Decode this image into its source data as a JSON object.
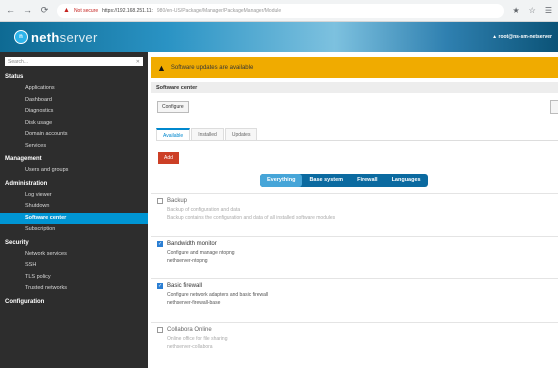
{
  "browser": {
    "nav_back": "←",
    "nav_forward": "→",
    "nav_reload": "⟳",
    "nav_home": "⌂",
    "insecure_label": "Not secure",
    "url_host": "https://192.168.251.11:",
    "url_path": "980/en-US/Package/Manager/PackageManager/Module",
    "bar_icons": [
      "★",
      "☆",
      "☰"
    ]
  },
  "app": {
    "logo_mark": "n",
    "logo_word": "neth",
    "logo_word_light": "server",
    "user_label": "▲ root@ns-sm-netserver"
  },
  "sidebar": {
    "search_placeholder": "Search...",
    "search_clear": "✕",
    "sections": [
      {
        "title": "Status",
        "items": [
          "Applications",
          "Dashboard",
          "Diagnostics",
          "Disk usage",
          "Domain accounts",
          "Services"
        ]
      },
      {
        "title": "Management",
        "items": [
          "Users and groups"
        ]
      },
      {
        "title": "Administration",
        "items": [
          "Log viewer",
          "Shutdown",
          "Software center",
          "Subscription"
        ]
      },
      {
        "title": "Security",
        "items": [
          "Network services",
          "SSH",
          "TLS policy",
          "Trusted networks"
        ]
      },
      {
        "title": "Configuration",
        "items": []
      }
    ],
    "active_item": "Software center"
  },
  "alert": {
    "icon": "▲",
    "text": "Software updates are available"
  },
  "panel": {
    "title": "Software center",
    "configure_button": "Configure"
  },
  "tabs": [
    "Available",
    "Installed",
    "Updates"
  ],
  "active_tab": "Available",
  "add_button": "Add",
  "filters": [
    "Everything",
    "Base system",
    "Firewall",
    "Languages"
  ],
  "active_filter": "Everything",
  "packages": [
    {
      "name": "Backup",
      "desc": "Backup of configuration and data",
      "sub": "Backup contains the configuration and data of all installed software modules",
      "checked": false,
      "dim": true
    },
    {
      "name": "Bandwidth monitor",
      "desc": "Configure and manage ntopng",
      "sub": "nethserver-ntopng",
      "checked": true,
      "dim": false
    },
    {
      "name": "Basic firewall",
      "desc": "Configure network adapters and basic firewall",
      "sub": "nethserver-firewall-base",
      "checked": true,
      "dim": false
    },
    {
      "name": "Collabora Online",
      "desc": "Online office for file sharing",
      "sub": "nethserver-collabora",
      "checked": false,
      "dim": true
    }
  ]
}
